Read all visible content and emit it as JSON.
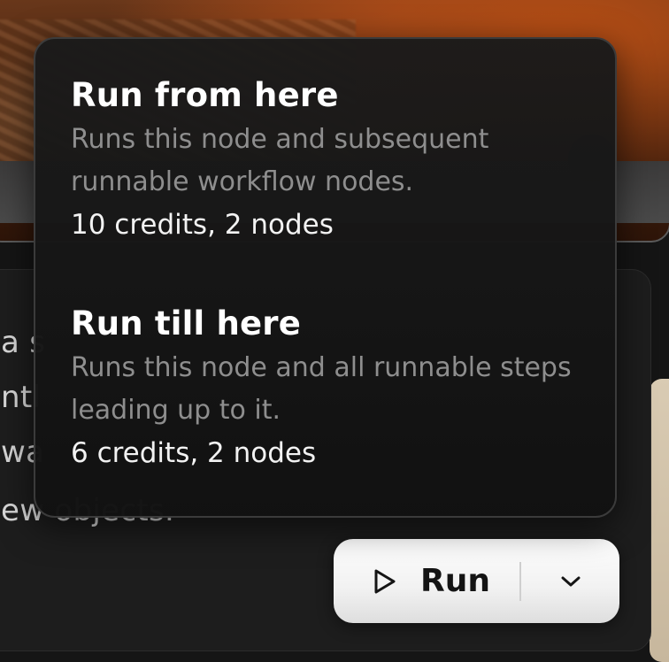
{
  "canvas": {
    "text_node": {
      "prompt_lines": [
        "a s",
        "ntl",
        "wa",
        "ew objects."
      ]
    }
  },
  "run_control": {
    "run_label": "Run",
    "icons": {
      "run": "play-icon",
      "dropdown": "chevron-down-icon"
    }
  },
  "run_menu": {
    "items": [
      {
        "title": "Run from here",
        "description": "Runs this node and subsequent runnable workflow nodes.",
        "cost": "10 credits, 2 nodes"
      },
      {
        "title": "Run till here",
        "description": "Runs this node and all runnable steps leading up to it.",
        "cost": "6 credits, 2 nodes"
      }
    ]
  }
}
